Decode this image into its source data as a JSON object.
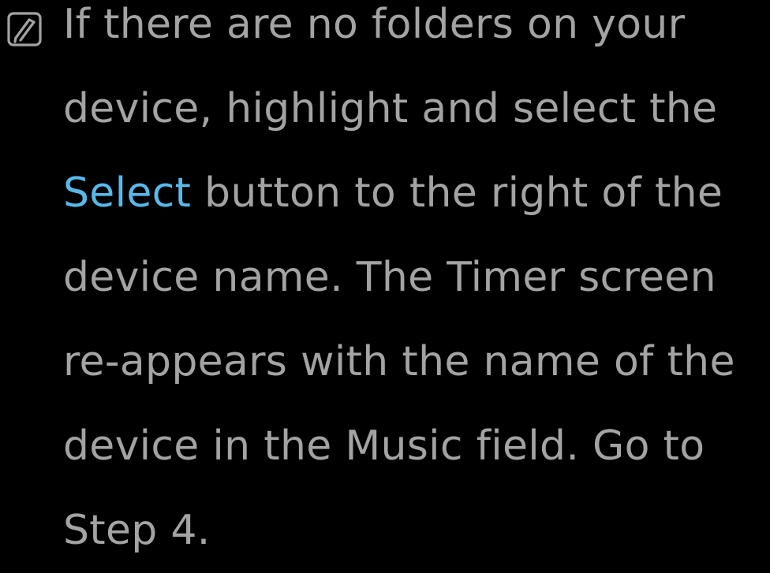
{
  "note": {
    "icon": "note-pencil-icon",
    "lines": [
      {
        "pre": "If there are no folders on your"
      },
      {
        "pre": "device, highlight and select the"
      },
      {
        "highlight": "Select",
        "post": " button to the right of the"
      },
      {
        "pre": "device name. The Timer screen"
      },
      {
        "pre": "re-appears with the name of the"
      },
      {
        "pre": "device in the Music field. Go to"
      },
      {
        "pre": "Step 4."
      }
    ]
  },
  "colors": {
    "background": "#000000",
    "text": "#a3a3a3",
    "highlight": "#57b9ea",
    "icon": "#a3a3a3"
  }
}
